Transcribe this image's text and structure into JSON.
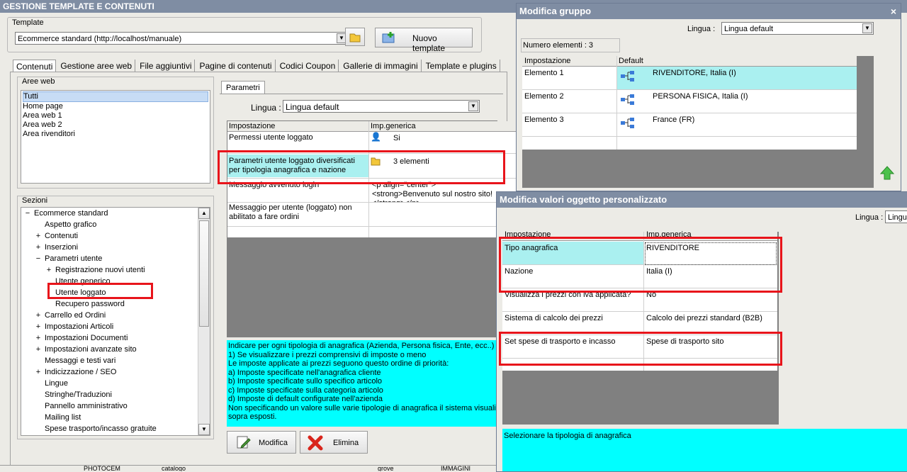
{
  "app_title": "GESTIONE TEMPLATE E CONTENUTI",
  "template": {
    "label": "Template",
    "value": "Ecommerce standard (http://localhost/manuale)",
    "new_button": "Nuovo template"
  },
  "tabs": [
    "Contenuti",
    "Gestione aree web",
    "File aggiuntivi",
    "Pagine di contenuti",
    "Codici Coupon",
    "Gallerie di immagini",
    "Template e plugins"
  ],
  "aree_web": {
    "label": "Aree web",
    "items": [
      "Tutti",
      "Home page",
      "Area web 1",
      "Area web 2",
      "Area rivenditori"
    ]
  },
  "sezioni": {
    "label": "Sezioni",
    "items": [
      {
        "indent": 0,
        "exp": "−",
        "label": "Ecommerce standard"
      },
      {
        "indent": 1,
        "exp": "",
        "label": "Aspetto grafico"
      },
      {
        "indent": 1,
        "exp": "+",
        "label": "Contenuti"
      },
      {
        "indent": 1,
        "exp": "+",
        "label": "Inserzioni"
      },
      {
        "indent": 1,
        "exp": "−",
        "label": "Parametri utente"
      },
      {
        "indent": 2,
        "exp": "+",
        "label": "Registrazione nuovi utenti"
      },
      {
        "indent": 2,
        "exp": "",
        "label": "Utente generico"
      },
      {
        "indent": 2,
        "exp": "",
        "label": "Utente loggato"
      },
      {
        "indent": 2,
        "exp": "",
        "label": "Recupero password"
      },
      {
        "indent": 1,
        "exp": "+",
        "label": "Carrello ed Ordini"
      },
      {
        "indent": 1,
        "exp": "+",
        "label": "Impostazioni Articoli"
      },
      {
        "indent": 1,
        "exp": "+",
        "label": "Impostazioni Documenti"
      },
      {
        "indent": 1,
        "exp": "+",
        "label": "Impostazioni avanzate sito"
      },
      {
        "indent": 1,
        "exp": "",
        "label": "Messaggi e testi vari"
      },
      {
        "indent": 1,
        "exp": "+",
        "label": "Indicizzazione / SEO"
      },
      {
        "indent": 1,
        "exp": "",
        "label": "Lingue"
      },
      {
        "indent": 1,
        "exp": "",
        "label": "Stringhe/Traduzioni"
      },
      {
        "indent": 1,
        "exp": "",
        "label": "Pannello amministrativo"
      },
      {
        "indent": 1,
        "exp": "",
        "label": "Mailing list"
      },
      {
        "indent": 1,
        "exp": "",
        "label": "Spese trasporto/incasso gratuite"
      }
    ]
  },
  "parametri": {
    "tab": "Parametri",
    "lingua_label": "Lingua :",
    "lingua_value": "Lingua default",
    "col1": "Impostazione",
    "col2": "Imp.generica",
    "rows": [
      {
        "name": "Permessi utente loggato",
        "value": "Si"
      },
      {
        "name": "Parametri utente loggato diversificati per tipologia anagrafica e nazione",
        "value": "3 elementi"
      },
      {
        "name": "Messaggio avvenuto login",
        "value": "<p align=\"center\"><strong>Benvenuto sul nostro sito!</strong></p>"
      },
      {
        "name": "Messaggio per utente (loggato) non abilitato a fare ordini",
        "value": ""
      }
    ],
    "help": "Indicare per ogni tipologia di anagrafica (Azienda, Persona fisica, Ente, ecc..) e\n1) Se visualizzare i prezzi comprensivi di imposte o meno\nLe imposte applicate ai prezzi seguono questo ordine di priorità:\na) Imposte specificate nell'anagrafica cliente\nb) Imposte specificate sullo specifico articolo\nc) Imposte specificate sulla categoria articolo\nd) Imposte di default configurate nell'azienda\nNon specificando un valore sulle varie tipologie di anagrafica il sistema visualizz\nsopra esposti.",
    "modifica": "Modifica",
    "elimina": "Elimina"
  },
  "bottom_bar": [
    "PHOTOCEM",
    "catalogo",
    "grove",
    "IMMAGINI"
  ],
  "modifica_gruppo": {
    "title": "Modifica gruppo",
    "close": "×",
    "lingua_label": "Lingua :",
    "lingua_value": "Lingua default",
    "count": "Numero elementi : 3",
    "col1": "Impostazione",
    "col2": "Default",
    "rows": [
      {
        "name": "Elemento 1",
        "value": "RIVENDITORE, Italia (I)"
      },
      {
        "name": "Elemento 2",
        "value": "PERSONA FISICA, Italia (I)"
      },
      {
        "name": "Elemento 3",
        "value": "France (FR)"
      }
    ]
  },
  "modifica_valori": {
    "title": "Modifica valori oggetto personalizzato",
    "lingua_label": "Lingua :",
    "lingua_value": "Lingu",
    "col1": "Impostazione",
    "col2": "Imp.generica",
    "rows": [
      {
        "name": "Tipo anagrafica",
        "value": "RIVENDITORE"
      },
      {
        "name": "Nazione",
        "value": "Italia (I)"
      },
      {
        "name": "Visualizza i prezzi con iva applicata?",
        "value": "No"
      },
      {
        "name": "Sistema di calcolo dei prezzi",
        "value": "Calcolo dei prezzi standard (B2B)"
      },
      {
        "name": "Set spese di trasporto e incasso",
        "value": "Spese di trasporto sito"
      }
    ],
    "help": "Selezionare la tipologia di anagrafica"
  }
}
